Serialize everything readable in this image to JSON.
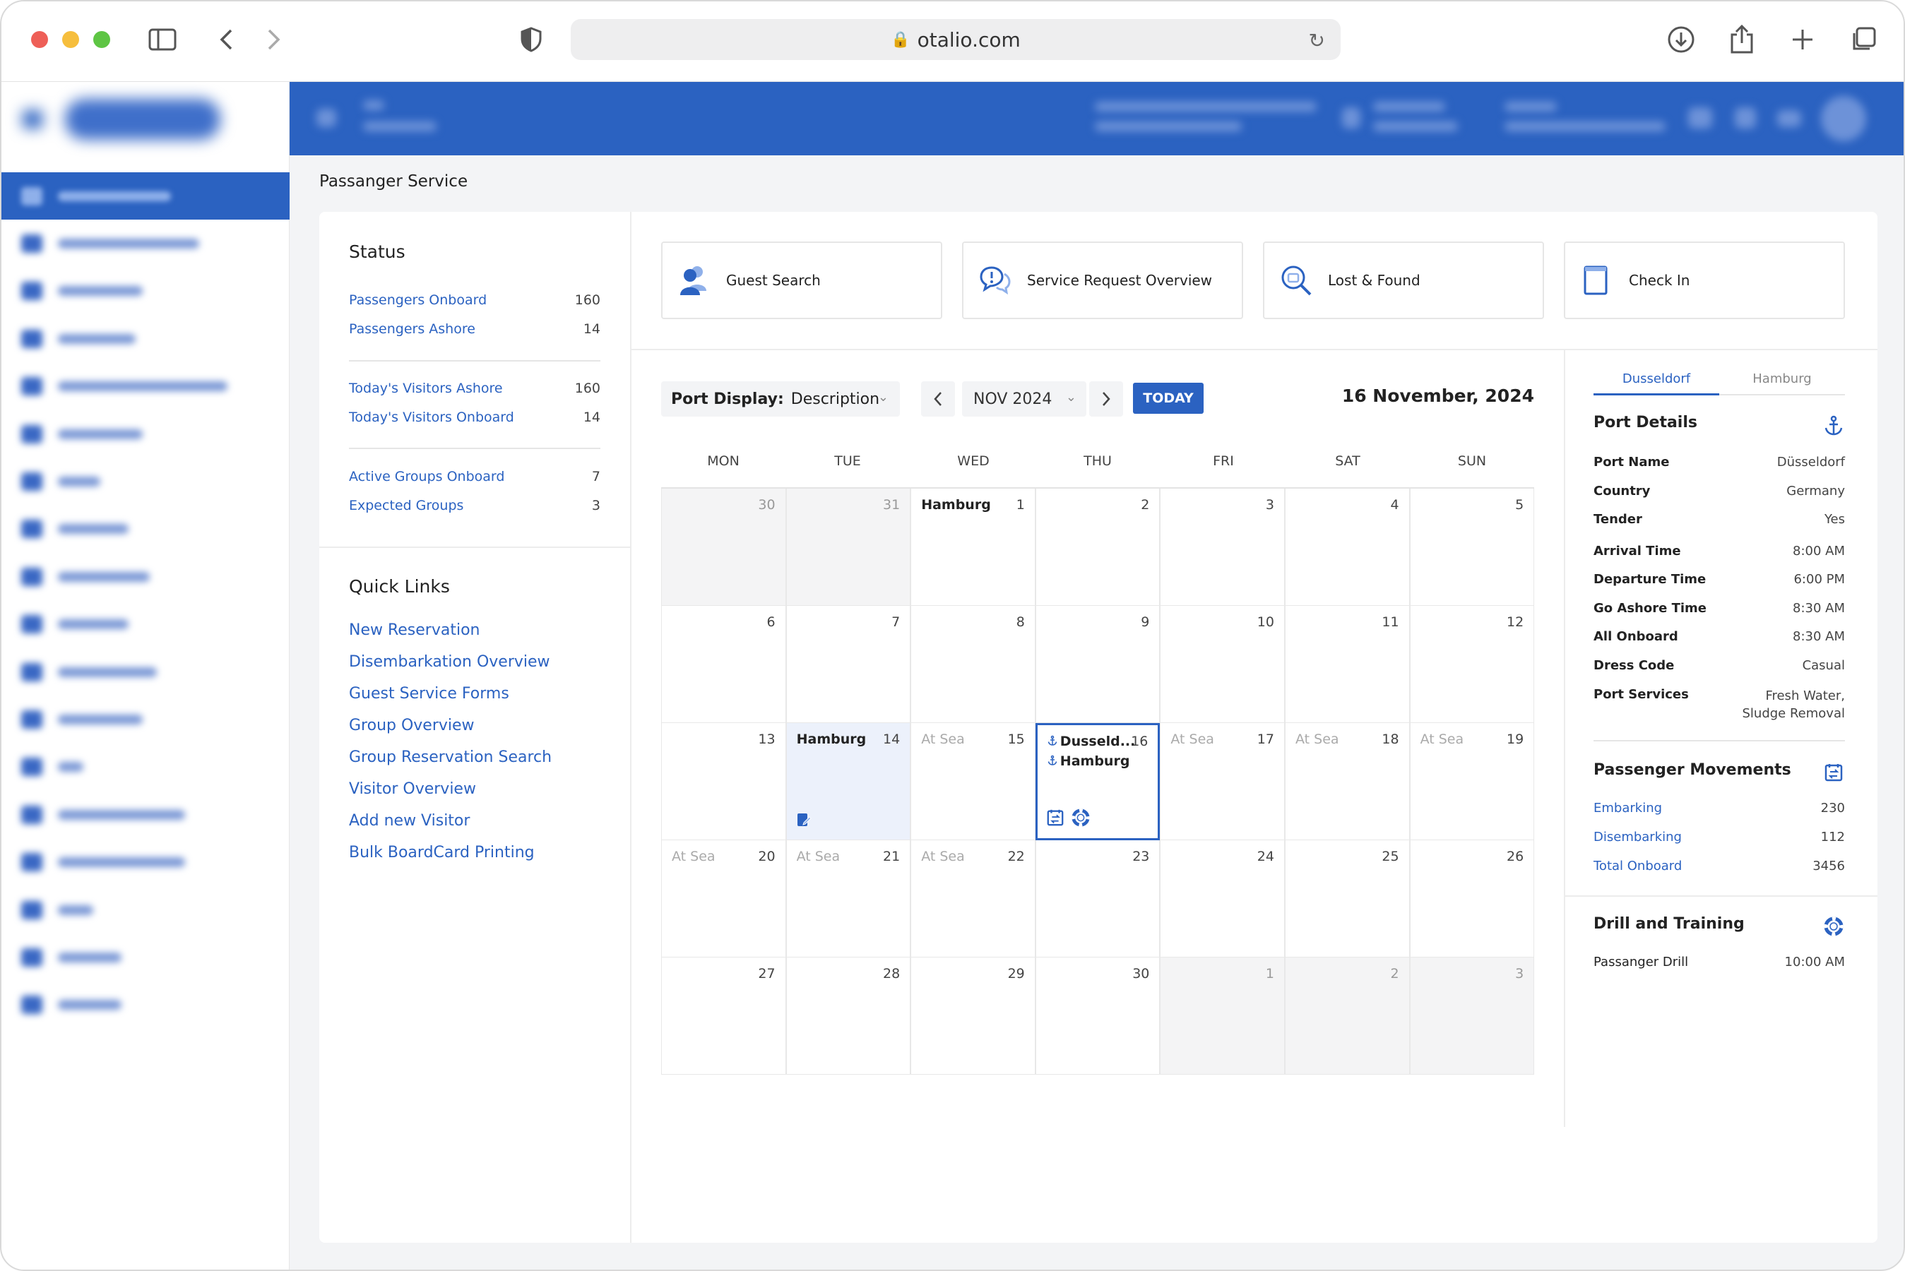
{
  "browser": {
    "url": "otalio.com"
  },
  "page": {
    "title": "Passanger Service"
  },
  "status": {
    "heading": "Status",
    "groups": [
      [
        {
          "label": "Passengers Onboard",
          "value": "160"
        },
        {
          "label": "Passengers Ashore",
          "value": "14"
        }
      ],
      [
        {
          "label": "Today's Visitors Ashore",
          "value": "160"
        },
        {
          "label": "Today's Visitors Onboard",
          "value": "14"
        }
      ],
      [
        {
          "label": "Active Groups Onboard",
          "value": "7"
        },
        {
          "label": "Expected Groups",
          "value": "3"
        }
      ]
    ]
  },
  "quick_links": {
    "heading": "Quick Links",
    "items": [
      "New Reservation",
      "Disembarkation Overview",
      "Guest Service Forms",
      "Group Overview",
      "Group Reservation Search",
      "Visitor Overview",
      "Add new Visitor",
      "Bulk BoardCard Printing"
    ]
  },
  "tiles": [
    {
      "label": "Guest Search",
      "icon": "guests-icon"
    },
    {
      "label": "Service Request Overview",
      "icon": "service-request-icon"
    },
    {
      "label": "Lost & Found",
      "icon": "lost-found-icon"
    },
    {
      "label": "Check In",
      "icon": "check-in-icon"
    }
  ],
  "calendar": {
    "port_display_label": "Port Display:",
    "port_display_value": "Description",
    "month": "NOV 2024",
    "today_label": "TODAY",
    "date_title": "16 November, 2024",
    "weekdays": [
      "MON",
      "TUE",
      "WED",
      "THU",
      "FRI",
      "SAT",
      "SUN"
    ],
    "weeks": [
      [
        {
          "d": "30",
          "muted": true
        },
        {
          "d": "31",
          "muted": true
        },
        {
          "d": "1",
          "port": "Hamburg"
        },
        {
          "d": "2"
        },
        {
          "d": "3"
        },
        {
          "d": "4"
        },
        {
          "d": "5"
        }
      ],
      [
        {
          "d": "6"
        },
        {
          "d": "7"
        },
        {
          "d": "8"
        },
        {
          "d": "9"
        },
        {
          "d": "10"
        },
        {
          "d": "11"
        },
        {
          "d": "12"
        }
      ],
      [
        {
          "d": "13"
        },
        {
          "d": "14",
          "port": "Hamburg",
          "hl": true,
          "events": [
            "form-icon"
          ]
        },
        {
          "d": "15",
          "sea": "At Sea"
        },
        {
          "d": "16",
          "port": "Dusseld...",
          "port2": "Hamburg",
          "sel": true,
          "events": [
            "transfer-icon",
            "lifebuoy-icon"
          ]
        },
        {
          "d": "17",
          "sea": "At Sea"
        },
        {
          "d": "18",
          "sea": "At Sea"
        },
        {
          "d": "19",
          "sea": "At Sea"
        }
      ],
      [
        {
          "d": "20",
          "sea": "At Sea"
        },
        {
          "d": "21",
          "sea": "At Sea"
        },
        {
          "d": "22",
          "sea": "At Sea"
        },
        {
          "d": "23"
        },
        {
          "d": "24"
        },
        {
          "d": "25"
        },
        {
          "d": "26"
        }
      ],
      [
        {
          "d": "27"
        },
        {
          "d": "28"
        },
        {
          "d": "29"
        },
        {
          "d": "30"
        },
        {
          "d": "1",
          "muted": true
        },
        {
          "d": "2",
          "muted": true
        },
        {
          "d": "3",
          "muted": true
        }
      ]
    ]
  },
  "right_panel": {
    "tabs": [
      "Dusseldorf",
      "Hamburg"
    ],
    "port_details": {
      "heading": "Port Details",
      "rows": [
        {
          "k": "Port Name",
          "v": "Düsseldorf"
        },
        {
          "k": "Country",
          "v": "Germany"
        },
        {
          "k": "Tender",
          "v": "Yes"
        },
        {
          "k": "Arrival Time",
          "v": "8:00 AM"
        },
        {
          "k": "Departure Time",
          "v": "6:00 PM"
        },
        {
          "k": "Go Ashore Time",
          "v": "8:30 AM"
        },
        {
          "k": "All Onboard",
          "v": "8:30 AM"
        },
        {
          "k": "Dress Code",
          "v": "Casual"
        },
        {
          "k": "Port Services",
          "v": "Fresh Water,",
          "v2": "Sludge Removal"
        }
      ]
    },
    "movements": {
      "heading": "Passenger Movements",
      "rows": [
        {
          "k": "Embarking",
          "v": "230"
        },
        {
          "k": "Disembarking",
          "v": "112"
        },
        {
          "k": "Total Onboard",
          "v": "3456"
        }
      ]
    },
    "drill": {
      "heading": "Drill and Training",
      "rows": [
        {
          "k": "Passanger Drill",
          "v": "10:00 AM"
        }
      ]
    }
  },
  "colors": {
    "brand": "#2b62c1"
  }
}
